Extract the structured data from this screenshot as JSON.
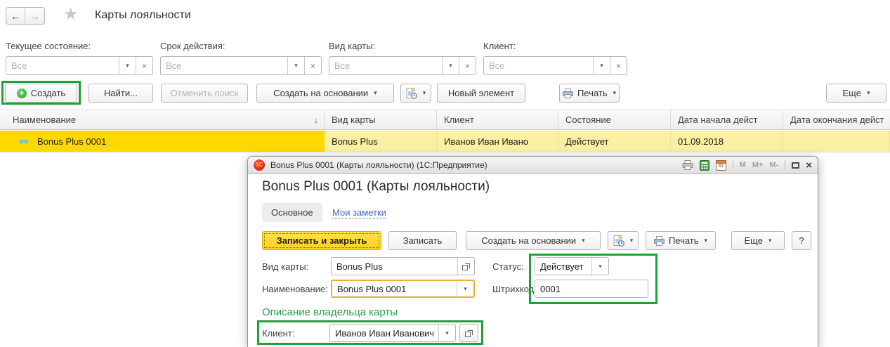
{
  "colors": {
    "annotation_green": "#21a038",
    "selected_row_yellow": "#ffd800",
    "row_highlight_yellow": "#fbf0a2",
    "primary_button_yellow": "#ffd021",
    "focused_field_orange": "#efae34",
    "section_heading_green": "#2b9d4f",
    "link_blue": "#3e68c0"
  },
  "icons": {
    "back": "←",
    "forward": "→",
    "star": "★",
    "plus": "+",
    "dropdown": "▾",
    "clear": "×",
    "sort_desc": "↓",
    "close": "×",
    "memory": "M",
    "memory_plus": "M+",
    "memory_minus": "M-"
  },
  "header": {
    "title": "Карты лояльности"
  },
  "filters": [
    {
      "label": "Текущее состояние:",
      "placeholder": "Все",
      "value": ""
    },
    {
      "label": "Срок действия:",
      "placeholder": "Все",
      "value": ""
    },
    {
      "label": "Вид карты:",
      "placeholder": "Все",
      "value": ""
    },
    {
      "label": "Клиент:",
      "placeholder": "Все",
      "value": ""
    }
  ],
  "toolbar": {
    "create": "Создать",
    "find": "Найти...",
    "cancel_search": "Отменить поиск",
    "create_based_on": "Создать на основании",
    "new_element": "Новый элемент",
    "print": "Печать",
    "more": "Еще"
  },
  "table": {
    "columns": [
      "Наименование",
      "Вид карты",
      "Клиент",
      "Состояние",
      "Дата начала дейст",
      "Дата окончания дейст"
    ],
    "rows": [
      {
        "name": "Bonus Plus 0001",
        "card_type": "Bonus Plus",
        "client": "Иванов Иван Ивано",
        "state": "Действует",
        "start_date": "01.09.2018",
        "end_date": ""
      }
    ]
  },
  "dialog": {
    "window_title": "Bonus Plus 0001 (Карты лояльности)  (1С:Предприятие)",
    "titlebar": {
      "calendar_day": "31"
    },
    "title": "Bonus Plus 0001 (Карты лояльности)",
    "tabs": {
      "main": "Основное",
      "notes": "Мои заметки"
    },
    "toolbar": {
      "save_close": "Записать и закрыть",
      "save": "Записать",
      "create_based_on": "Создать на основании",
      "print": "Печать",
      "more": "Еще",
      "help": "?"
    },
    "fields": {
      "card_type": {
        "label": "Вид карты:",
        "value": "Bonus Plus"
      },
      "status": {
        "label": "Статус:",
        "value": "Действует"
      },
      "name": {
        "label": "Наименование:",
        "value": "Bonus Plus 0001"
      },
      "barcode": {
        "label": "Штрихкод:",
        "value": "0001"
      },
      "client": {
        "label": "Клиент:",
        "value": "Иванов Иван Иванович"
      }
    },
    "section_heading": "Описание владельца карты"
  }
}
